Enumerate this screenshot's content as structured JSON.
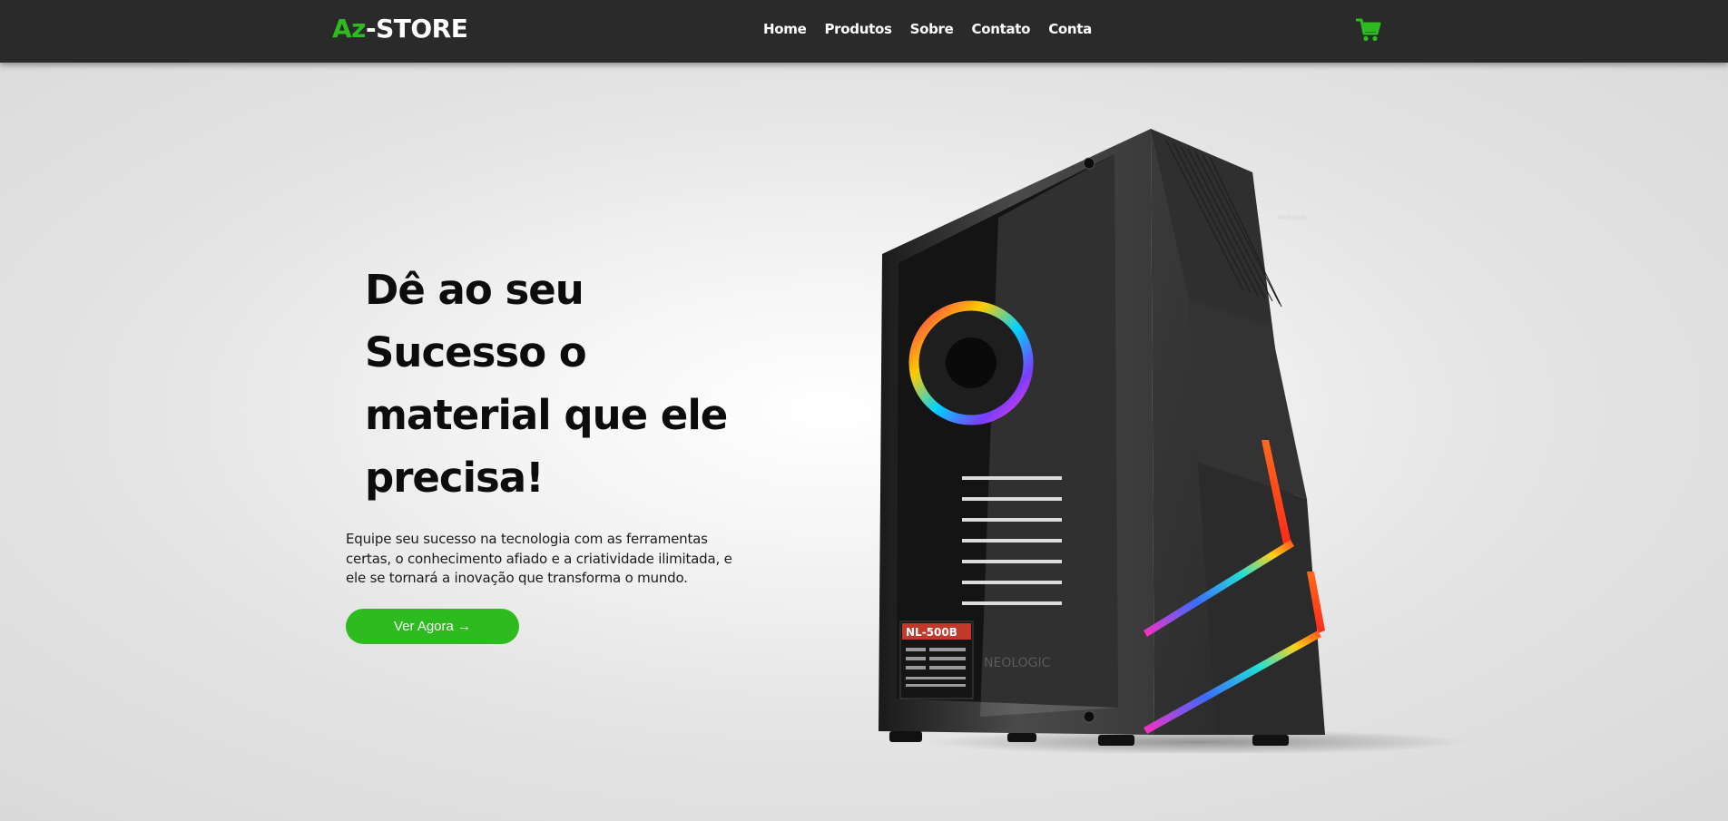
{
  "brand": {
    "prefix": "Az",
    "suffix": "-STORE"
  },
  "nav": {
    "items": [
      {
        "label": "Home"
      },
      {
        "label": "Produtos"
      },
      {
        "label": "Sobre"
      },
      {
        "label": "Contato"
      },
      {
        "label": "Conta"
      }
    ],
    "cart_icon": "shopping-cart-icon"
  },
  "hero": {
    "title": "Dê ao seu Sucesso o material que ele precisa!",
    "description": "Equipe seu sucesso na tecnologia com as ferramentas certas, o conhecimento afiado e a criatividade ilimitada, e ele se tornará a inovação que transforma o mundo.",
    "cta_label": "Ver Agora →"
  },
  "product": {
    "image": "pc-case-image",
    "brand_mark": "NEOLOGIC",
    "psu_label": "NL-500B"
  },
  "colors": {
    "accent": "#2dbb1f",
    "navbar": "#2a2a2a",
    "text": "#0c0c0c"
  }
}
